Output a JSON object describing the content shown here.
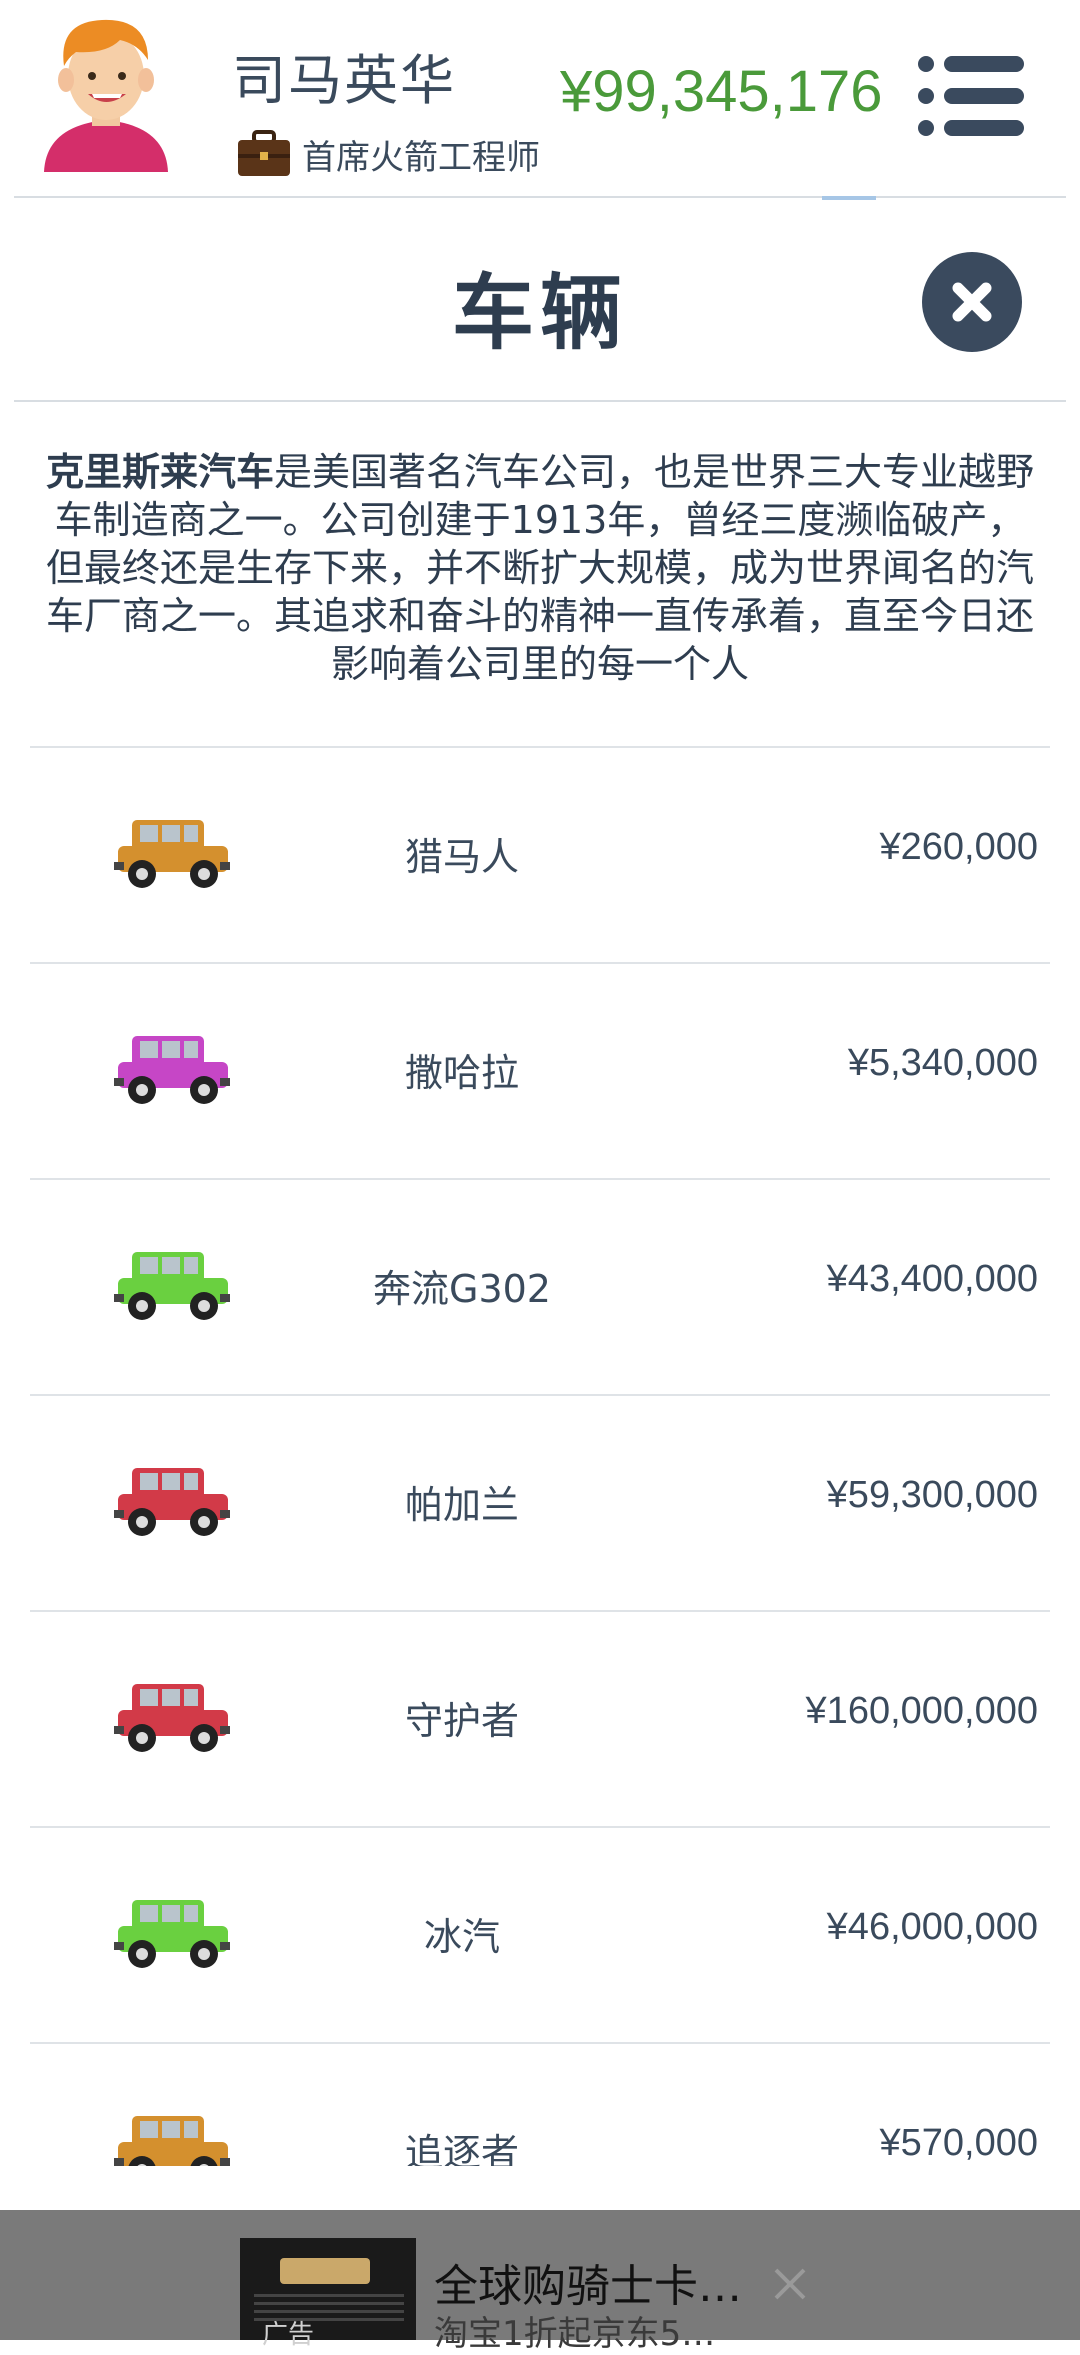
{
  "player": {
    "name": "司马英华",
    "job_title": "首席火箭工程师",
    "money": "¥99,345,176"
  },
  "page": {
    "title": "车辆"
  },
  "description": {
    "brand": "克里斯莱汽车",
    "text": "是美国著名汽车公司，也是世界三大专业越野车制造商之一。公司创建于1913年，曾经三度濒临破产，但最终还是生存下来，并不断扩大规模，成为世界闻名的汽车厂商之一。其追求和奋斗的精神一直传承着，直至今日还影响着公司里的每一个人"
  },
  "vehicles": [
    {
      "name": "猎马人",
      "price": "¥260,000",
      "color": "#d4902e"
    },
    {
      "name": "撒哈拉",
      "price": "¥5,340,000",
      "color": "#c646c6"
    },
    {
      "name": "奔流G302",
      "price": "¥43,400,000",
      "color": "#6ad040"
    },
    {
      "name": "帕加兰",
      "price": "¥59,300,000",
      "color": "#d23a48"
    },
    {
      "name": "守护者",
      "price": "¥160,000,000",
      "color": "#d23a48"
    },
    {
      "name": "冰汽",
      "price": "¥46,000,000",
      "color": "#6ad040"
    },
    {
      "name": "追逐者",
      "price": "¥570,000",
      "color": "#d4902e"
    }
  ],
  "ad": {
    "tag": "广告",
    "title": "全球购骑士卡…",
    "subtitle": "淘宝1折起京东5…"
  },
  "colors": {
    "money": "#4a9a3a",
    "text": "#2e3d4f",
    "close_button": "#3a4a5e",
    "ad_background": "#7a7a7a"
  },
  "icons": [
    "avatar",
    "briefcase-icon",
    "menu-list-icon",
    "close-icon",
    "car-icon"
  ]
}
